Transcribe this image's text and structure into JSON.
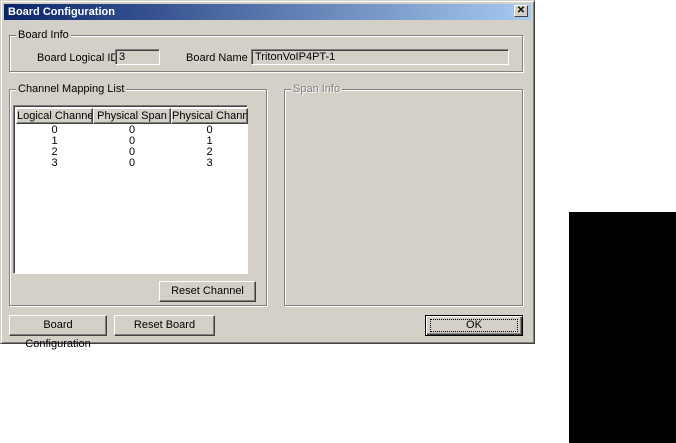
{
  "window": {
    "title": "Board Configuration",
    "close_glyph": "✕"
  },
  "board_info": {
    "legend": "Board Info",
    "logical_id_label": "Board Logical ID",
    "logical_id_value": "3",
    "board_name_label": "Board Name",
    "board_name_value": "TritonVoIP4PT-1"
  },
  "channel_mapping": {
    "legend": "Channel Mapping List",
    "columns": [
      "Logical Channel",
      "Physical Span",
      "Physical Channel"
    ],
    "rows": [
      [
        "0",
        "0",
        "0"
      ],
      [
        "1",
        "0",
        "1"
      ],
      [
        "2",
        "0",
        "2"
      ],
      [
        "3",
        "0",
        "3"
      ]
    ],
    "reset_channel_label": "Reset Channel"
  },
  "span_info": {
    "legend": "Span Info"
  },
  "footer": {
    "board_configuration_label": "Board Configuration",
    "reset_board_label": "Reset Board",
    "ok_label": "OK"
  }
}
